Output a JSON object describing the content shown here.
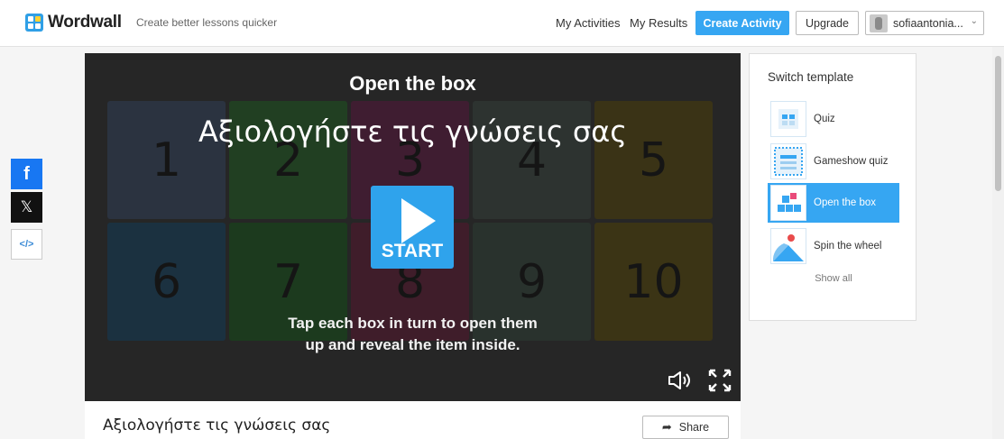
{
  "header": {
    "logo_text": "Wordwall",
    "tagline": "Create better lessons quicker",
    "nav": {
      "my_activities": "My Activities",
      "my_results": "My Results"
    },
    "create_button": "Create Activity",
    "upgrade_button": "Upgrade",
    "username": "sofiaantonia...",
    "accent_color": "#36a6f2"
  },
  "share_sidebar": {
    "facebook_icon": "f",
    "x_icon": "𝕏",
    "embed_icon": "</>"
  },
  "game": {
    "template_name": "Open the box",
    "activity_title": "Αξιολογήστε τις γνώσεις σας",
    "start_label": "START",
    "instructions_line1": "Tap each box in turn to open them",
    "instructions_line2": "up and reveal the item inside.",
    "boxes": [
      {
        "label": "1",
        "color": "#2b3340"
      },
      {
        "label": "2",
        "color": "#213f22"
      },
      {
        "label": "3",
        "color": "#3f1d31"
      },
      {
        "label": "4",
        "color": "#2d3330"
      },
      {
        "label": "5",
        "color": "#3a3316"
      },
      {
        "label": "6",
        "color": "#1b3140"
      },
      {
        "label": "7",
        "color": "#1c3a1e"
      },
      {
        "label": "8",
        "color": "#3f1d2a"
      },
      {
        "label": "9",
        "color": "#29322d"
      },
      {
        "label": "10",
        "color": "#3b3415"
      }
    ]
  },
  "template_panel": {
    "title": "Switch template",
    "items": [
      {
        "label": "Quiz",
        "icon": "quiz-icon"
      },
      {
        "label": "Gameshow quiz",
        "icon": "gameshow-quiz-icon"
      },
      {
        "label": "Open the box",
        "icon": "open-the-box-icon",
        "active": true
      },
      {
        "label": "Spin the wheel",
        "icon": "spin-the-wheel-icon"
      }
    ],
    "show_all": "Show all"
  },
  "footer": {
    "activity_title": "Αξιολογήστε τις γνώσεις σας",
    "share_label": "Share"
  }
}
